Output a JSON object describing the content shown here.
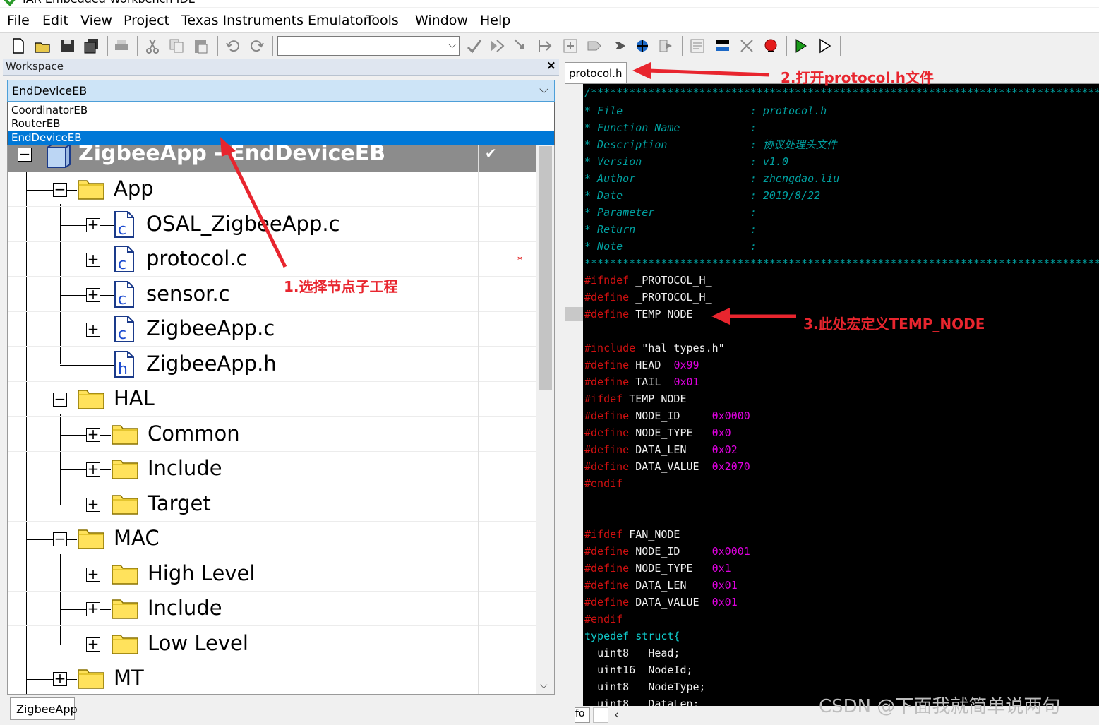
{
  "window": {
    "title": "IAR Embedded Workbench IDE"
  },
  "menubar": [
    "File",
    "Edit",
    "View",
    "Project",
    "Texas Instruments Emulator",
    "Tools",
    "Window",
    "Help"
  ],
  "workspace": {
    "title": "Workspace",
    "close": "×",
    "config_selected": "EndDeviceEB",
    "config_options": [
      "CoordinatorEB",
      "RouterEB",
      "EndDeviceEB"
    ],
    "project_label": "ZigbeeApp - EndDeviceEB",
    "check": "✔",
    "tree": [
      "App",
      "OSAL_ZigbeeApp.c",
      "protocol.c",
      "sensor.c",
      "ZigbeeApp.c",
      "ZigbeeApp.h",
      "HAL",
      "Common",
      "Include",
      "Target",
      "MAC",
      "High Level",
      "Include",
      "Low Level",
      "MT"
    ],
    "bottom_tab": "ZigbeeApp"
  },
  "editor": {
    "tab": "protocol.h",
    "bottom_box": "fo",
    "code": [
      "/******************************************************************************************",
      "* File                    : protocol.h",
      "* Function Name           :",
      "* Description             : 协议处理头文件",
      "* Version                 : v1.0",
      "* Author                  : zhengdao.liu",
      "* Date                    : 2019/8/22",
      "* Parameter               :",
      "* Return                  :",
      "* Note                    :",
      "******************************************************************************************",
      "#ifndef",
      "#define",
      "#define",
      "#include",
      "#define",
      "#define",
      "#ifdef",
      "#define",
      "#define",
      "#define",
      "#define",
      "#endif",
      "#ifdef",
      "#define",
      "#define",
      "#define",
      "#define",
      "#endif",
      "typedef struct{",
      "uint8",
      "uint16",
      "uint8",
      "uint8"
    ],
    "tokens": {
      "protocol_h": "_PROTOCOL_H_",
      "temp_node": "TEMP_NODE",
      "hal_types": "\"hal_types.h\"",
      "head": "HEAD",
      "head_val": "0x99",
      "tail": "TAIL",
      "tail_val": "0x01",
      "node_id": "NODE_ID",
      "node_type": "NODE_TYPE",
      "data_len": "DATA_LEN",
      "data_value": "DATA_VALUE",
      "t_node_id": "0x0000",
      "t_node_type": "0x0",
      "t_data_len": "0x02",
      "t_data_value": "0x2070",
      "fan_node": "FAN_NODE",
      "f_node_id": "0x0001",
      "f_node_type": "0x1",
      "f_data_len": "0x01",
      "f_data_value": "0x01",
      "f_head": "Head;",
      "f_nodeid": "NodeId;",
      "f_nodetype": "NodeType;",
      "f_datalen": "DataLen;"
    }
  },
  "annotations": {
    "a1": "1.选择节点子工程",
    "a2": "2.打开protocol.h文件",
    "a3": "3.此处宏定义TEMP_NODE"
  },
  "watermark": "CSDN @下面我就简单说两句",
  "colors": {
    "annotation": "#e8252e",
    "selection": "#0078d7",
    "preprocessor": "#d01010",
    "number": "#e000e0",
    "comment": "#00a0a0"
  }
}
